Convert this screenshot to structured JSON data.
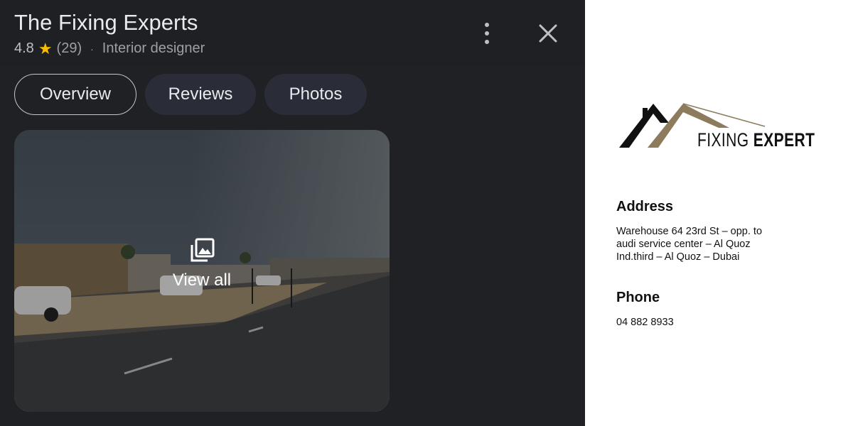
{
  "place": {
    "name": "The Fixing Experts",
    "rating": "4.8",
    "review_count": "(29)",
    "category": "Interior designer"
  },
  "tabs": [
    {
      "label": "Overview",
      "active": true
    },
    {
      "label": "Reviews",
      "active": false
    },
    {
      "label": "Photos",
      "active": false
    }
  ],
  "photo": {
    "view_all_label": "View all"
  },
  "icons": {
    "more": "more-vert-icon",
    "close": "close-icon",
    "star": "star-icon",
    "gallery": "photo-library-icon"
  },
  "colors": {
    "panel_bg": "#202124",
    "star": "#fbbc04",
    "logo_gold": "#8c7b5c"
  },
  "business_card": {
    "logo_text_regular": "FIXING",
    "logo_text_bold": "EXPERT",
    "address_heading": "Address",
    "address_lines": [
      "Warehouse 64 23rd St – opp. to",
      "audi service center – Al Quoz",
      "Ind.third – Al Quoz – Dubai"
    ],
    "phone_heading": "Phone",
    "phone": "04 882 8933"
  }
}
